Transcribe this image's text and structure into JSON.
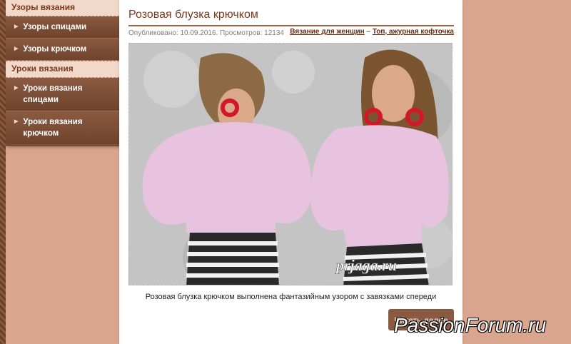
{
  "sidebar": {
    "sections": [
      {
        "heading": "Узоры вязания",
        "items": [
          {
            "label": "Узоры спицами"
          },
          {
            "label": "Узоры крючком"
          }
        ]
      },
      {
        "heading": "Уроки вязания",
        "items": [
          {
            "label": "Уроки вязания спицами"
          },
          {
            "label": "Уроки вязания крючком"
          }
        ]
      }
    ]
  },
  "article": {
    "title": "Розовая блузка крючком",
    "meta": "Опубликовано: 10.09.2016. Просмотров: 12134",
    "tags": {
      "first": "Вязание для женщин",
      "separator": " – ",
      "second": "Топ, ажурная кофточка"
    },
    "photo_watermark": "prjaga.ru",
    "caption": "Розовая блузка крючком выполнена фантазийным узором с завязками спереди",
    "read_more": "Читать далее"
  },
  "overlay_watermark": "PassionForum.ru",
  "colors": {
    "page_bg": "#d9a58e",
    "sidebar_bg": "#7a4a33",
    "heading_bg": "#f2d8c8",
    "title_color": "#7a3a1e",
    "blouse": "#e7c3df"
  },
  "icons": {
    "menu_arrow": "triangle-right-icon"
  }
}
